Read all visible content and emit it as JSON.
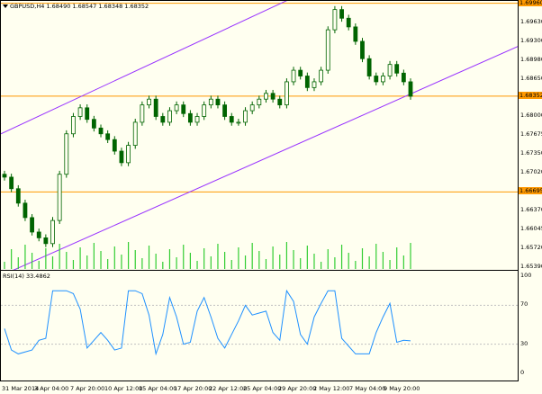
{
  "chart": {
    "symbol_line": "GBPUSD,H4  1.68490 1.68547 1.68348 1.68352",
    "price_levels": [
      "1.69960",
      "1.69630",
      "1.69300",
      "1.68980",
      "1.68650",
      "1.68352",
      "1.68000",
      "1.67675",
      "1.67350",
      "1.67020",
      "1.66695",
      "1.66370",
      "1.66045",
      "1.65720",
      "1.65390"
    ],
    "highlighted_levels": {
      "top": "1.69960",
      "mid": "1.68352",
      "low": "1.66695"
    },
    "time_labels": [
      "31 Mar 2014",
      "3 Apr 04:00",
      "7 Apr 20:00",
      "10 Apr 12:00",
      "15 Apr 04:00",
      "17 Apr 20:00",
      "22 Apr 12:00",
      "25 Apr 04:00",
      "29 Apr 20:00",
      "2 May 12:00",
      "7 May 04:00",
      "9 May 20:00"
    ],
    "colors": {
      "bg": "#fffff0",
      "candle": "#006400",
      "channel": "#9933ff",
      "hline": "#ff9900",
      "volume": "#32cd32",
      "rsi": "#1e90ff",
      "grid": "#c0c0c0"
    }
  },
  "rsi": {
    "label": "RSI(14) 33.4862",
    "levels": [
      "100",
      "70",
      "30",
      "0"
    ]
  },
  "chart_data": {
    "type": "candlestick",
    "symbol": "GBPUSD",
    "timeframe": "H4",
    "closes": [
      1.6695,
      1.6675,
      1.665,
      1.6625,
      1.66,
      1.659,
      1.658,
      1.662,
      1.67,
      1.677,
      1.68,
      1.6815,
      1.6795,
      1.678,
      1.677,
      1.676,
      1.674,
      1.672,
      1.675,
      1.679,
      1.682,
      1.683,
      1.68,
      1.679,
      1.681,
      1.682,
      1.6805,
      1.679,
      1.68,
      1.682,
      1.683,
      1.682,
      1.68,
      1.679,
      1.679,
      1.681,
      1.682,
      1.683,
      1.684,
      1.683,
      1.682,
      1.686,
      1.688,
      1.687,
      1.685,
      1.686,
      1.688,
      1.695,
      1.6985,
      1.697,
      1.6955,
      1.693,
      1.69,
      1.687,
      1.686,
      1.687,
      1.689,
      1.6875,
      1.686,
      1.6835
    ],
    "channel": {
      "upper_start": 1.677,
      "upper_end": 1.7,
      "lower_start": 1.654,
      "lower_end": 1.689
    },
    "horizontal_lines": [
      1.6996,
      1.68352,
      1.66695
    ],
    "rsi_last": 33.4862
  }
}
